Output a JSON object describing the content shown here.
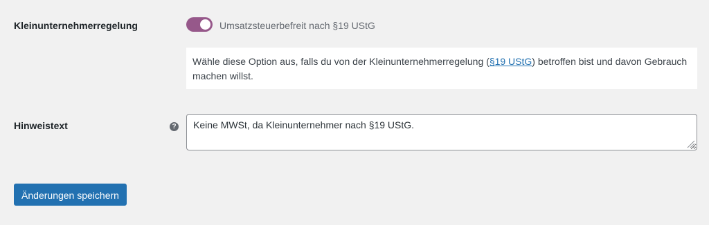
{
  "settings": {
    "kleinunternehmer": {
      "label": "Kleinunternehmerregelung",
      "toggle_on": true,
      "toggle_label": "Umsatzsteuerbefreit nach §19 UStG",
      "toggle_color": "#96588a",
      "description_before": "Wähle diese Option aus, falls du von der Kleinunternehmerregelung (",
      "description_link": "§19 UStG",
      "description_after": ") betroffen bist und davon Gebrauch machen willst."
    },
    "hinweistext": {
      "label": "Hinweistext",
      "help_icon": "question-circle-icon",
      "value": "Keine MWSt, da Kleinunternehmer nach §19 UStG."
    }
  },
  "actions": {
    "save_label": "Änderungen speichern",
    "save_color": "#2271b1"
  }
}
